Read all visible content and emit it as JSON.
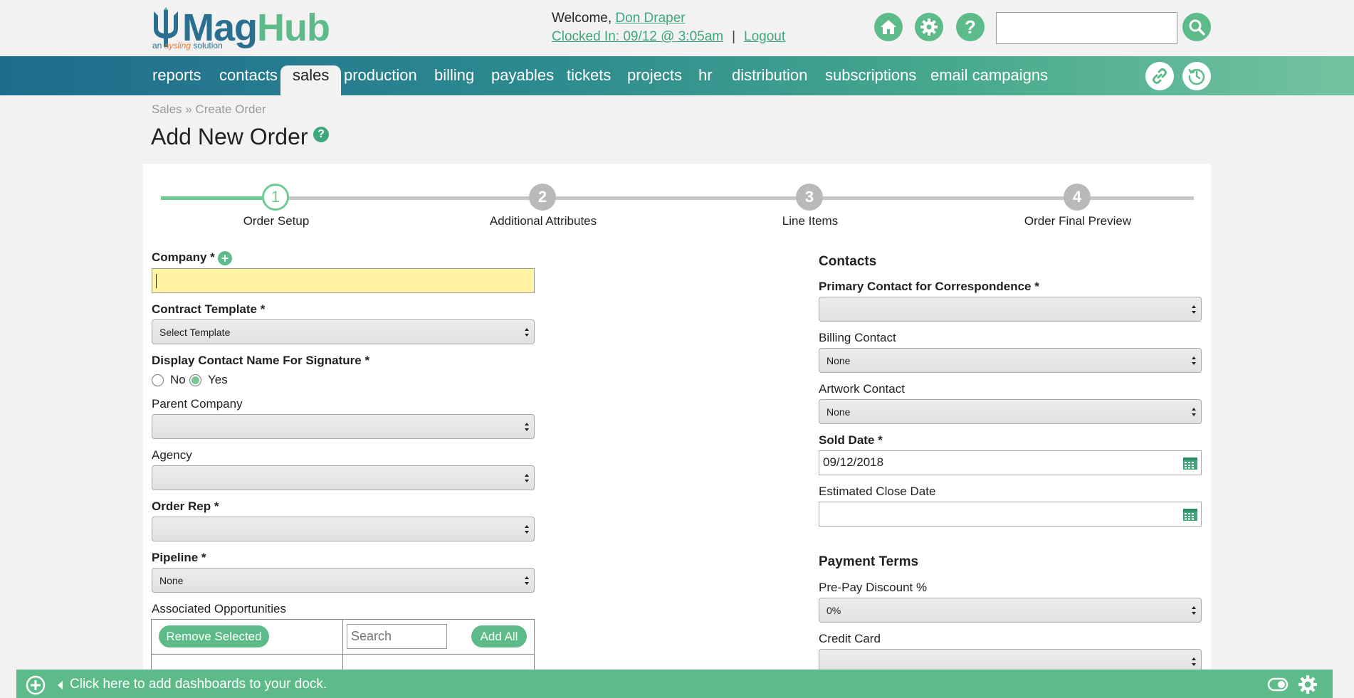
{
  "header": {
    "logo_text_part1": "Mag",
    "logo_text_part2": "Hub",
    "logo_tagline_pre": "an ",
    "logo_tagline_brand": "aysling",
    "logo_tagline_post": " solution",
    "welcome_prefix": "Welcome, ",
    "user_name": "Don Draper",
    "clocked_in": "Clocked In: 09/12 @ 3:05am",
    "separator": "|",
    "logout": "Logout",
    "search_value": ""
  },
  "nav": {
    "items": [
      "reports",
      "contacts",
      "sales",
      "production",
      "billing",
      "payables",
      "tickets",
      "projects",
      "hr",
      "distribution",
      "subscriptions",
      "email campaigns"
    ],
    "active": "sales"
  },
  "page": {
    "breadcrumb": "Sales » Create Order",
    "title": "Add New Order",
    "help_symbol": "?"
  },
  "stepper": {
    "steps": [
      {
        "number": "1",
        "label": "Order Setup",
        "state": "current"
      },
      {
        "number": "2",
        "label": "Additional Attributes",
        "state": "pending"
      },
      {
        "number": "3",
        "label": "Line Items",
        "state": "pending"
      },
      {
        "number": "4",
        "label": "Order Final Preview",
        "state": "pending"
      }
    ]
  },
  "left_form": {
    "company_label": "Company *",
    "company_value": "",
    "contract_template_label": "Contract Template *",
    "contract_template_value": "Select Template",
    "display_contact_label": "Display Contact Name For Signature *",
    "radio_no": "No",
    "radio_yes": "Yes",
    "radio_selected": "Yes",
    "parent_company_label": "Parent Company",
    "parent_company_value": "",
    "agency_label": "Agency",
    "agency_value": "",
    "order_rep_label": "Order Rep *",
    "order_rep_value": "",
    "pipeline_label": "Pipeline *",
    "pipeline_value": "None",
    "associated_opps_label": "Associated Opportunities",
    "remove_selected": "Remove Selected",
    "search_placeholder": "Search",
    "add_all": "Add All"
  },
  "right_form": {
    "contacts_heading": "Contacts",
    "primary_contact_label": "Primary Contact for Correspondence *",
    "primary_contact_value": "",
    "billing_contact_label": "Billing Contact",
    "billing_contact_value": "None",
    "artwork_contact_label": "Artwork Contact",
    "artwork_contact_value": "None",
    "sold_date_label": "Sold Date *",
    "sold_date_value": "09/12/2018",
    "estimated_close_label": "Estimated Close Date",
    "estimated_close_value": "",
    "payment_terms_heading": "Payment Terms",
    "prepay_discount_label": "Pre-Pay Discount %",
    "prepay_discount_value": "0%",
    "credit_card_label": "Credit Card",
    "credit_card_value": ""
  },
  "dock": {
    "text": "Click here to add dashboards to your dock."
  },
  "colors": {
    "accent": "#5dbb8a",
    "link": "#3fa77c",
    "nav_start": "#1f6b8e",
    "nav_end": "#74c3a0",
    "required_highlight": "#fff4a3"
  }
}
